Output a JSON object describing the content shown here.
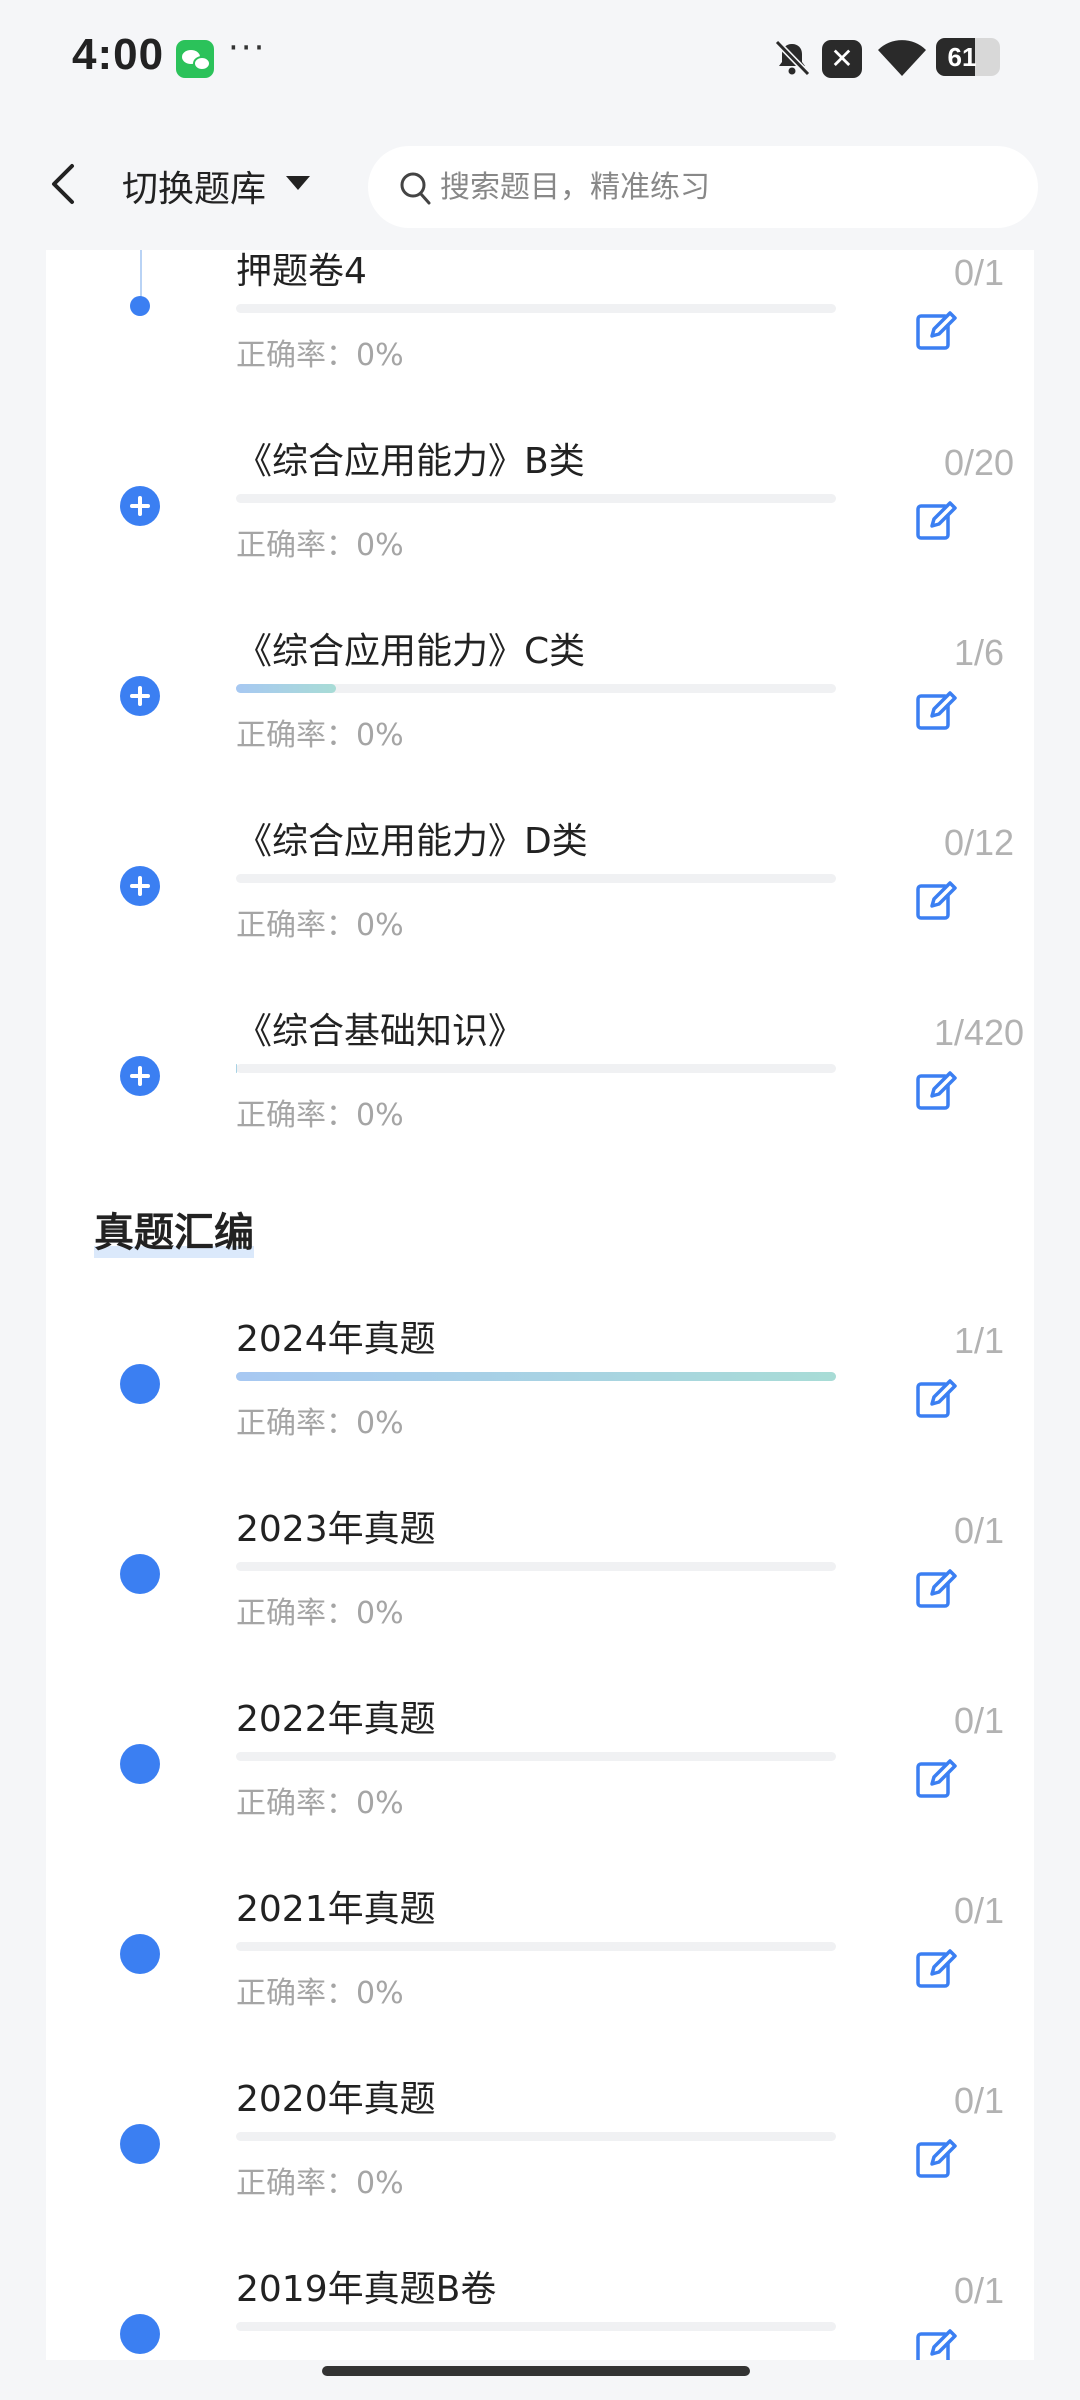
{
  "status_bar": {
    "time": "4:00",
    "more": "···",
    "battery_level": "61",
    "battery_fraction": 0.61,
    "icons": [
      "wechat-icon",
      "bell-off-icon",
      "close-notification-icon",
      "wifi-icon",
      "battery-icon"
    ]
  },
  "header": {
    "switch_label": "切换题库",
    "search_placeholder": "搜索题目，精准练习"
  },
  "accuracy_label": "正确率：",
  "groups": [
    {
      "items": [
        {
          "title": "押题卷4",
          "progress": 0,
          "accuracy": "0%",
          "count": "0/1",
          "marker": "dot"
        },
        {
          "title": "《综合应用能力》B类",
          "progress": 0,
          "accuracy": "0%",
          "count": "0/20",
          "marker": "plus"
        },
        {
          "title": "《综合应用能力》C类",
          "progress": 0.1667,
          "accuracy": "0%",
          "count": "1/6",
          "marker": "plus"
        },
        {
          "title": "《综合应用能力》D类",
          "progress": 0,
          "accuracy": "0%",
          "count": "0/12",
          "marker": "plus"
        },
        {
          "title": "《综合基础知识》",
          "progress": 0.0024,
          "accuracy": "0%",
          "count": "1/420",
          "marker": "plus"
        }
      ]
    },
    {
      "section_title": "真题汇编",
      "items": [
        {
          "title": "2024年真题",
          "progress": 1,
          "accuracy": "0%",
          "count": "1/1",
          "marker": "dot"
        },
        {
          "title": "2023年真题",
          "progress": 0,
          "accuracy": "0%",
          "count": "0/1",
          "marker": "dot"
        },
        {
          "title": "2022年真题",
          "progress": 0,
          "accuracy": "0%",
          "count": "0/1",
          "marker": "dot"
        },
        {
          "title": "2021年真题",
          "progress": 0,
          "accuracy": "0%",
          "count": "0/1",
          "marker": "dot"
        },
        {
          "title": "2020年真题",
          "progress": 0,
          "accuracy": "0%",
          "count": "0/1",
          "marker": "dot"
        },
        {
          "title": "2019年真题B卷",
          "progress": 0,
          "accuracy": "",
          "count": "0/1",
          "marker": "dot"
        }
      ]
    }
  ],
  "colors": {
    "accent": "#3b7ff2",
    "muted": "#a5a5a5",
    "count": "#b2b2b2"
  }
}
